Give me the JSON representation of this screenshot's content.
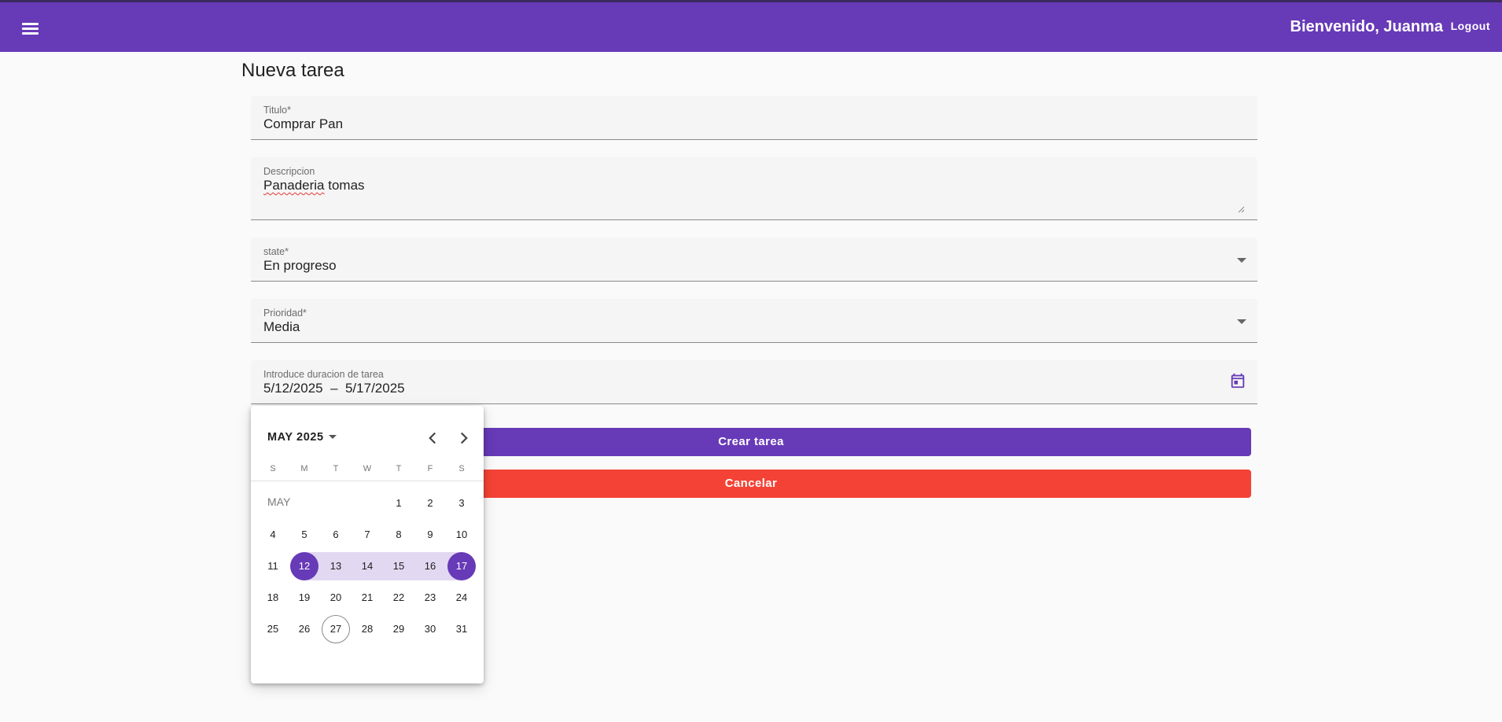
{
  "header": {
    "welcome": "Bienvenido, Juanma",
    "logout": "Logout",
    "menu_icon": "menu-icon",
    "bg_color": "#673ab7"
  },
  "page": {
    "title": "Nueva tarea"
  },
  "form": {
    "title": {
      "label": "Titulo*",
      "value": "Comprar Pan"
    },
    "description": {
      "label": "Descripcion",
      "value_misspelled": "Panaderia",
      "value_rest": " tomas"
    },
    "state": {
      "label": "state*",
      "value": "En progreso"
    },
    "priority": {
      "label": "Prioridad*",
      "value": "Media"
    },
    "duration": {
      "label": "Introduce duracion de tarea",
      "value": "5/12/2025  –  5/17/2025",
      "icon": "calendar-icon"
    }
  },
  "buttons": {
    "create": "Crear tarea",
    "cancel": "Cancelar",
    "create_color": "#673ab7",
    "cancel_color": "#f44336"
  },
  "datepicker": {
    "period": "MAY 2025",
    "month_label": "MAY",
    "weekdays": [
      "S",
      "M",
      "T",
      "W",
      "T",
      "F",
      "S"
    ],
    "first_weekday_index": 4,
    "days_in_month": 31,
    "range_start": 12,
    "range_end": 17,
    "today": 27,
    "prev_icon": "chevron-left-icon",
    "next_icon": "chevron-right-icon",
    "accent": "#673ab7",
    "range_color": "#e2d8f1"
  }
}
